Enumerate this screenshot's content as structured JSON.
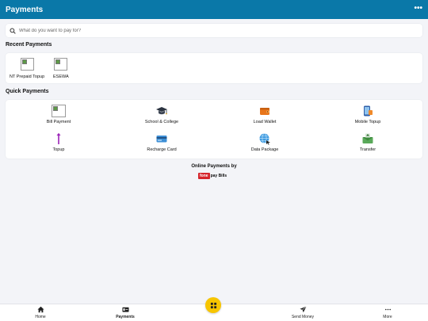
{
  "app": {
    "title": "Payments",
    "more_icon": "more-horizontal-icon"
  },
  "search": {
    "placeholder": "What do you want to pay for?",
    "icon": "search-icon"
  },
  "recent": {
    "title": "Recent Payments",
    "items": [
      {
        "label": "NT Prepaid Topup",
        "icon": "broken-image-icon"
      },
      {
        "label": "ESEWA",
        "icon": "broken-image-icon"
      }
    ]
  },
  "quick": {
    "title": "Quick Payments",
    "items": [
      {
        "label": "Bill Payment",
        "icon": "broken-image-icon"
      },
      {
        "label": "School & College",
        "icon": "graduation-cap-icon"
      },
      {
        "label": "Load Wallet",
        "icon": "wallet-icon"
      },
      {
        "label": "Mobile Topup",
        "icon": "mobile-phone-icon"
      },
      {
        "label": "Topup",
        "icon": "up-arrow-icon"
      },
      {
        "label": "Recharge Card",
        "icon": "credit-card-icon"
      },
      {
        "label": "Data Package",
        "icon": "globe-icon"
      },
      {
        "label": "Transfer",
        "icon": "transfer-envelope-icon"
      }
    ]
  },
  "footer": {
    "powered_by": "Online Payments by",
    "brand_logo": "fone",
    "brand_text": "pay Bills"
  },
  "tabs": [
    {
      "label": "Home",
      "icon": "home-icon",
      "active": false
    },
    {
      "label": "Payments",
      "icon": "payments-icon",
      "active": true
    },
    {
      "label": "Send Money",
      "icon": "send-icon",
      "active": false
    },
    {
      "label": "More",
      "icon": "more-horizontal-icon",
      "active": false
    }
  ],
  "fab": {
    "icon": "qr-scan-icon"
  },
  "colors": {
    "appbar": "#0a78a8",
    "fab": "#f7c500",
    "background": "#f3f4f8",
    "brand_red": "#d5242b"
  }
}
